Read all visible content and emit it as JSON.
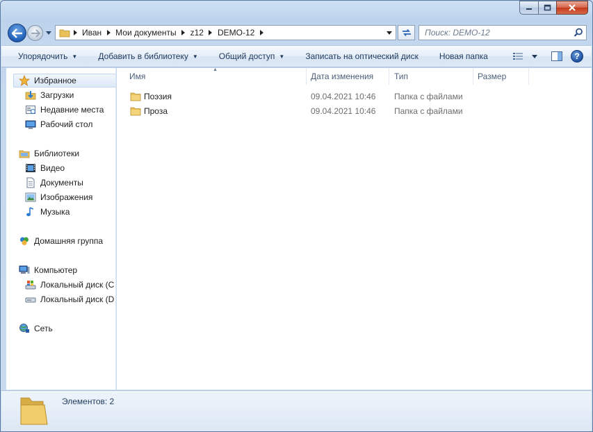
{
  "window": {
    "caption": {
      "minimize": "—",
      "maximize": "☐",
      "close": "✕"
    }
  },
  "address": {
    "crumbs": [
      "Иван",
      "Мои документы",
      "z12",
      "DEMO-12"
    ]
  },
  "search": {
    "placeholder": "Поиск: DEMO-12"
  },
  "toolbar": {
    "organize": "Упорядочить",
    "add_to_library": "Добавить в библиотеку",
    "share": "Общий доступ",
    "burn": "Записать на оптический диск",
    "new_folder": "Новая папка",
    "help": "?"
  },
  "sidebar": {
    "favorites": "Избранное",
    "downloads": "Загрузки",
    "recent": "Недавние места",
    "desktop": "Рабочий стол",
    "libraries": "Библиотеки",
    "video": "Видео",
    "documents": "Документы",
    "images": "Изображения",
    "music": "Музыка",
    "homegroup": "Домашняя группа",
    "computer": "Компьютер",
    "disk_c": "Локальный диск (C",
    "disk_d": "Локальный диск (D",
    "network": "Сеть"
  },
  "columns": {
    "name": "Имя",
    "date": "Дата изменения",
    "type": "Тип",
    "size": "Размер"
  },
  "files": [
    {
      "name": "Поэзия",
      "date": "09.04.2021 10:46",
      "type": "Папка с файлами"
    },
    {
      "name": "Проза",
      "date": "09.04.2021 10:46",
      "type": "Папка с файлами"
    }
  ],
  "details": {
    "count": "Элементов: 2"
  },
  "colors": {
    "accent": "#1e395b",
    "folder": "#e8c15a"
  }
}
